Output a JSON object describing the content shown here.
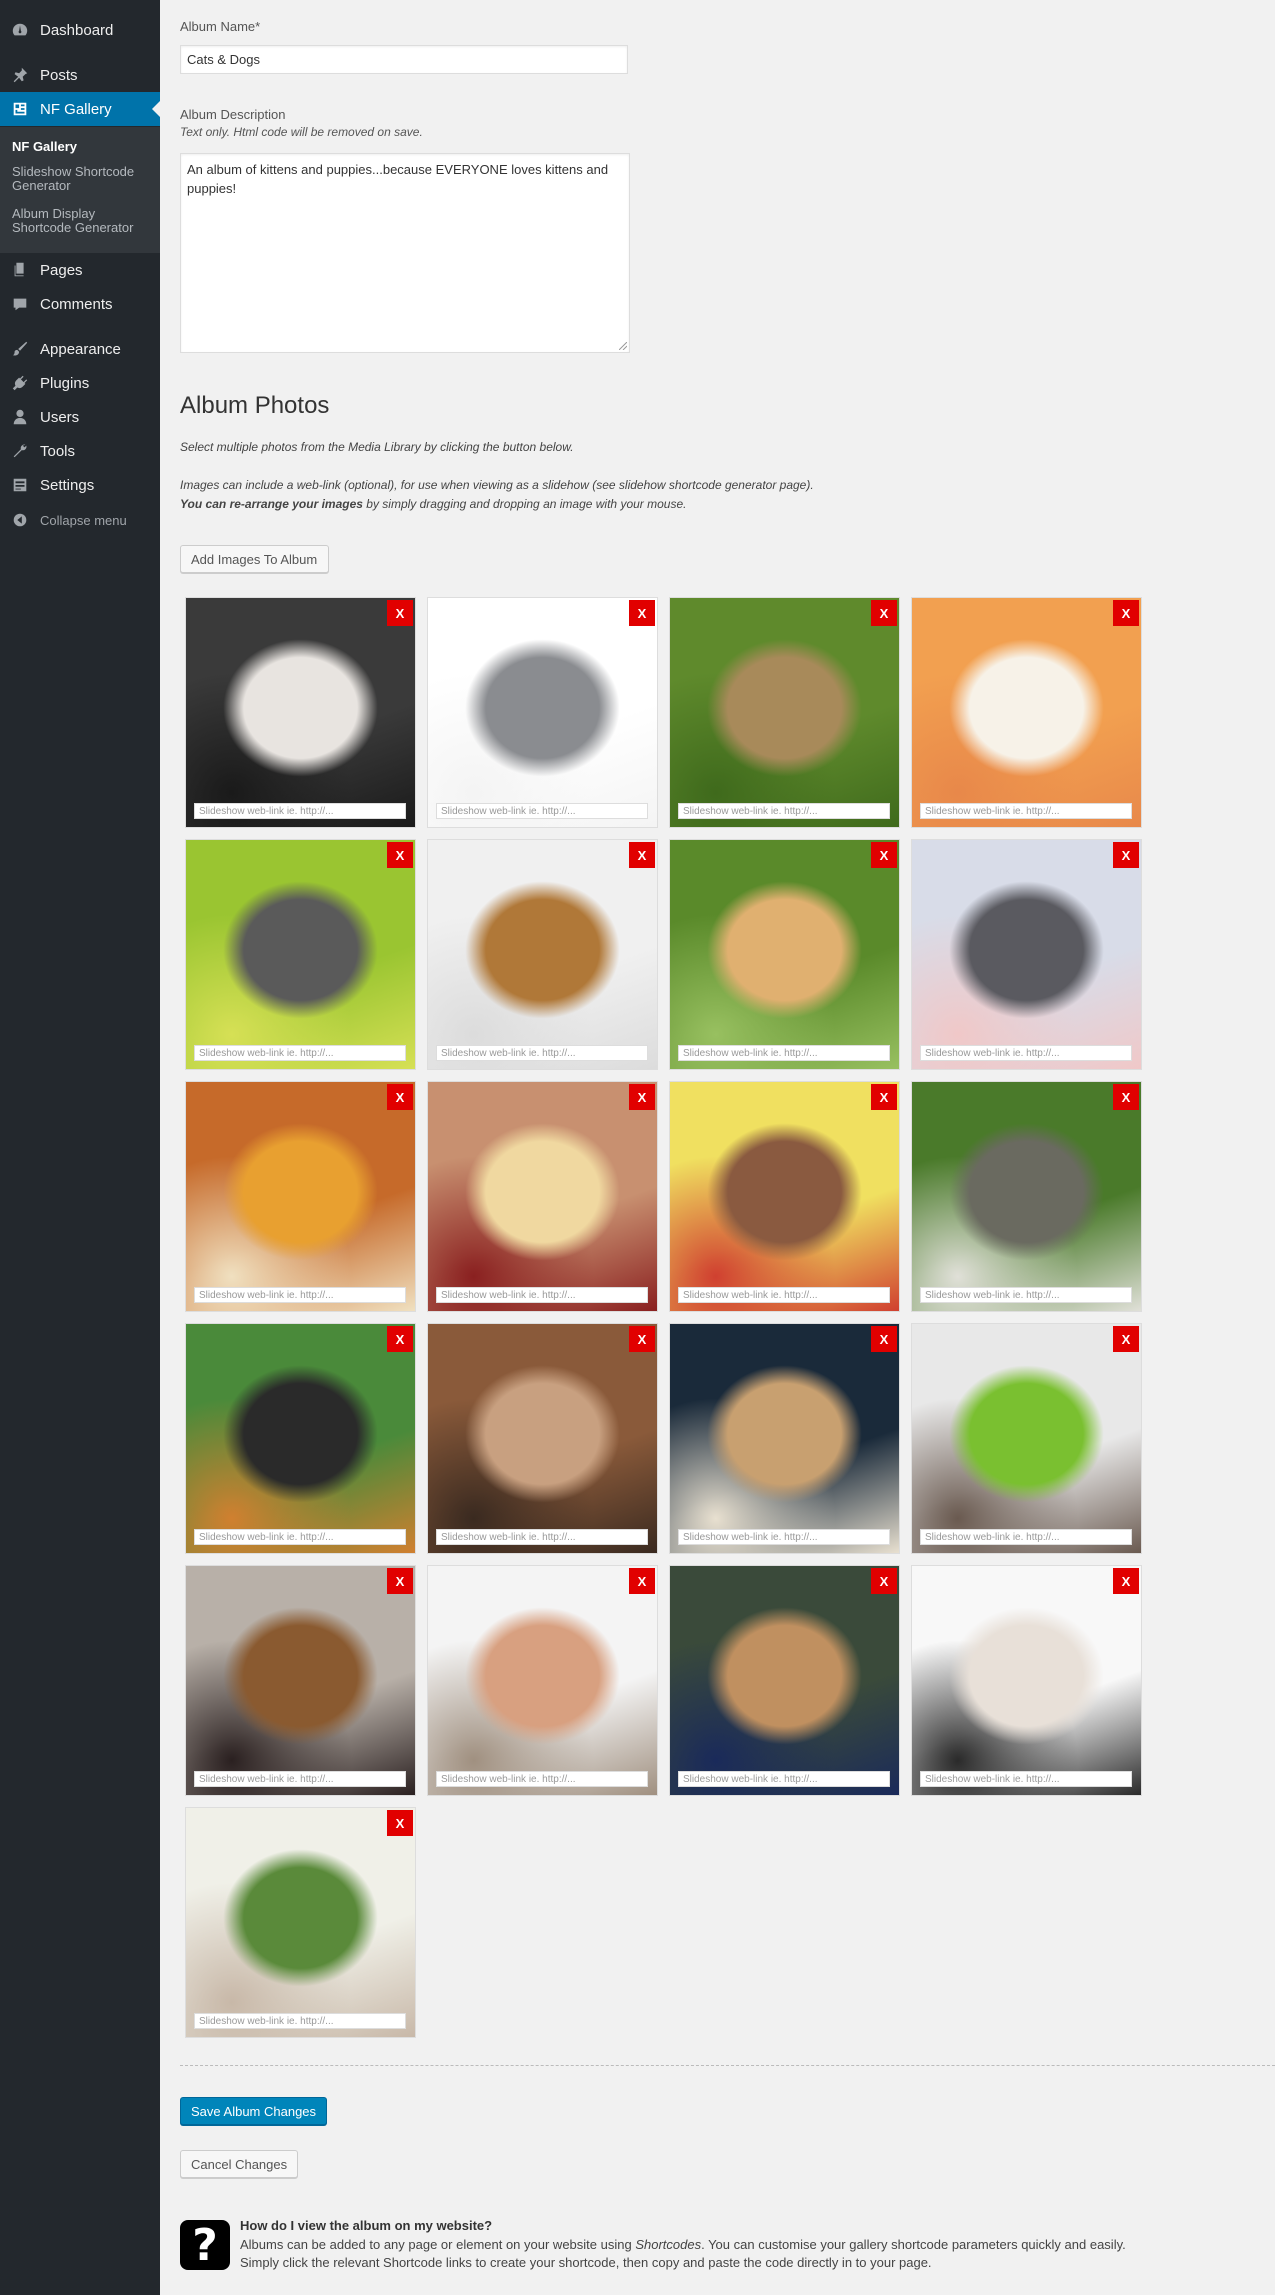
{
  "sidebar": {
    "items": [
      {
        "label": "Dashboard",
        "icon": "dashboard-icon"
      },
      {
        "label": "Posts",
        "icon": "pin-icon"
      },
      {
        "label": "NF Gallery",
        "icon": "gallery-icon",
        "active": true
      },
      {
        "label": "Pages",
        "icon": "pages-icon"
      },
      {
        "label": "Comments",
        "icon": "comments-icon"
      },
      {
        "label": "Appearance",
        "icon": "brush-icon"
      },
      {
        "label": "Plugins",
        "icon": "plugin-icon"
      },
      {
        "label": "Users",
        "icon": "user-icon"
      },
      {
        "label": "Tools",
        "icon": "wrench-icon"
      },
      {
        "label": "Settings",
        "icon": "settings-icon"
      }
    ],
    "submenu": [
      {
        "label": "NF Gallery",
        "current": true
      },
      {
        "label": "Slideshow Shortcode Generator"
      },
      {
        "label": "Album Display Shortcode Generator"
      }
    ],
    "collapse_label": "Collapse menu"
  },
  "form": {
    "album_name_label": "Album Name*",
    "album_name_value": "Cats & Dogs",
    "album_desc_label": "Album Description",
    "album_desc_note": "Text only. Html code will be removed on save.",
    "album_desc_value": "An album of kittens and puppies...because EVERYONE loves kittens and puppies!"
  },
  "photos_section": {
    "title": "Album Photos",
    "intro": "Select multiple photos from the Media Library by clicking the button below.",
    "weblink_note": "Images can include a web-link (optional), for use when viewing as a slidehow (see slidehow shortcode generator page).",
    "rearrange_bold": "You can re-arrange your images",
    "rearrange_rest": " by simply dragging and dropping an image with your mouse.",
    "add_button": "Add Images To Album",
    "remove_label": "X",
    "link_placeholder": "Slideshow web-link ie. http://...",
    "photos": [
      {
        "subject": "two husky puppies",
        "colors": [
          "#3a3a3a",
          "#e8e4e0",
          "#1a1a1a"
        ]
      },
      {
        "subject": "grey kitten",
        "colors": [
          "#ffffff",
          "#8a8c90",
          "#f4f4f4"
        ]
      },
      {
        "subject": "tabby kitten on grass",
        "colors": [
          "#5f8a2c",
          "#a88a5a",
          "#3f6a1c"
        ]
      },
      {
        "subject": "pomeranian puppy",
        "colors": [
          "#f2a050",
          "#f7f2e8",
          "#e8884a"
        ]
      },
      {
        "subject": "grey kitten running",
        "colors": [
          "#9ac531",
          "#5a5a5a",
          "#d6e055"
        ]
      },
      {
        "subject": "kitten on its back",
        "colors": [
          "#f0f0f0",
          "#b07838",
          "#dcdcdc"
        ]
      },
      {
        "subject": "golden retriever puppy",
        "colors": [
          "#5a8a2a",
          "#e0b070",
          "#98c060"
        ]
      },
      {
        "subject": "sleeping kitten with toy",
        "colors": [
          "#d8dce8",
          "#5a5a60",
          "#f0c8c8"
        ]
      },
      {
        "subject": "puppy peeking",
        "colors": [
          "#c66a2a",
          "#e8a030",
          "#f0e0c0"
        ]
      },
      {
        "subject": "shar pei puppies",
        "colors": [
          "#c89070",
          "#f0d8a0",
          "#8a2020"
        ]
      },
      {
        "subject": "puppy on yellow blanket",
        "colors": [
          "#f0e060",
          "#8a5a40",
          "#d04030"
        ]
      },
      {
        "subject": "grey kitten in grass",
        "colors": [
          "#4a7a2a",
          "#6a6a60",
          "#e0e0d8"
        ]
      },
      {
        "subject": "calico kitten",
        "colors": [
          "#4a8a3a",
          "#2a2a2a",
          "#d08030"
        ]
      },
      {
        "subject": "pile of teddy puppies",
        "colors": [
          "#8a5a3a",
          "#c8a080",
          "#3a2a20"
        ]
      },
      {
        "subject": "tabby kitten looking up",
        "colors": [
          "#1a2a3a",
          "#c8a070",
          "#e8e0d0"
        ]
      },
      {
        "subject": "kitten in frog hat",
        "colors": [
          "#e8e8e8",
          "#7ac030",
          "#6a5a50"
        ]
      },
      {
        "subject": "beagle puppy with paw",
        "colors": [
          "#b8b0a8",
          "#8a5a30",
          "#2a2020"
        ]
      },
      {
        "subject": "white kitten on hand",
        "colors": [
          "#f4f4f4",
          "#d8a080",
          "#a09080"
        ]
      },
      {
        "subject": "kitten playing with toy",
        "colors": [
          "#3a4a3a",
          "#c09060",
          "#1a2a5a"
        ]
      },
      {
        "subject": "white puppy",
        "colors": [
          "#f8f8f8",
          "#e8e0d8",
          "#2a2a2a"
        ]
      },
      {
        "subject": "fluffy white puppy",
        "colors": [
          "#f0f0e8",
          "#5a8a3a",
          "#c8b8a8"
        ]
      }
    ]
  },
  "actions": {
    "save": "Save Album Changes",
    "cancel": "Cancel Changes"
  },
  "help": {
    "title": "How do I view the album on my website?",
    "line1_a": "Albums can be added to any page or element on your website using ",
    "line1_em": "Shortcodes",
    "line1_b": ". You can customise your gallery shortcode parameters quickly and easily.",
    "line2": "Simply click the relevant Shortcode links to create your shortcode, then copy and paste the code directly in to your page."
  }
}
